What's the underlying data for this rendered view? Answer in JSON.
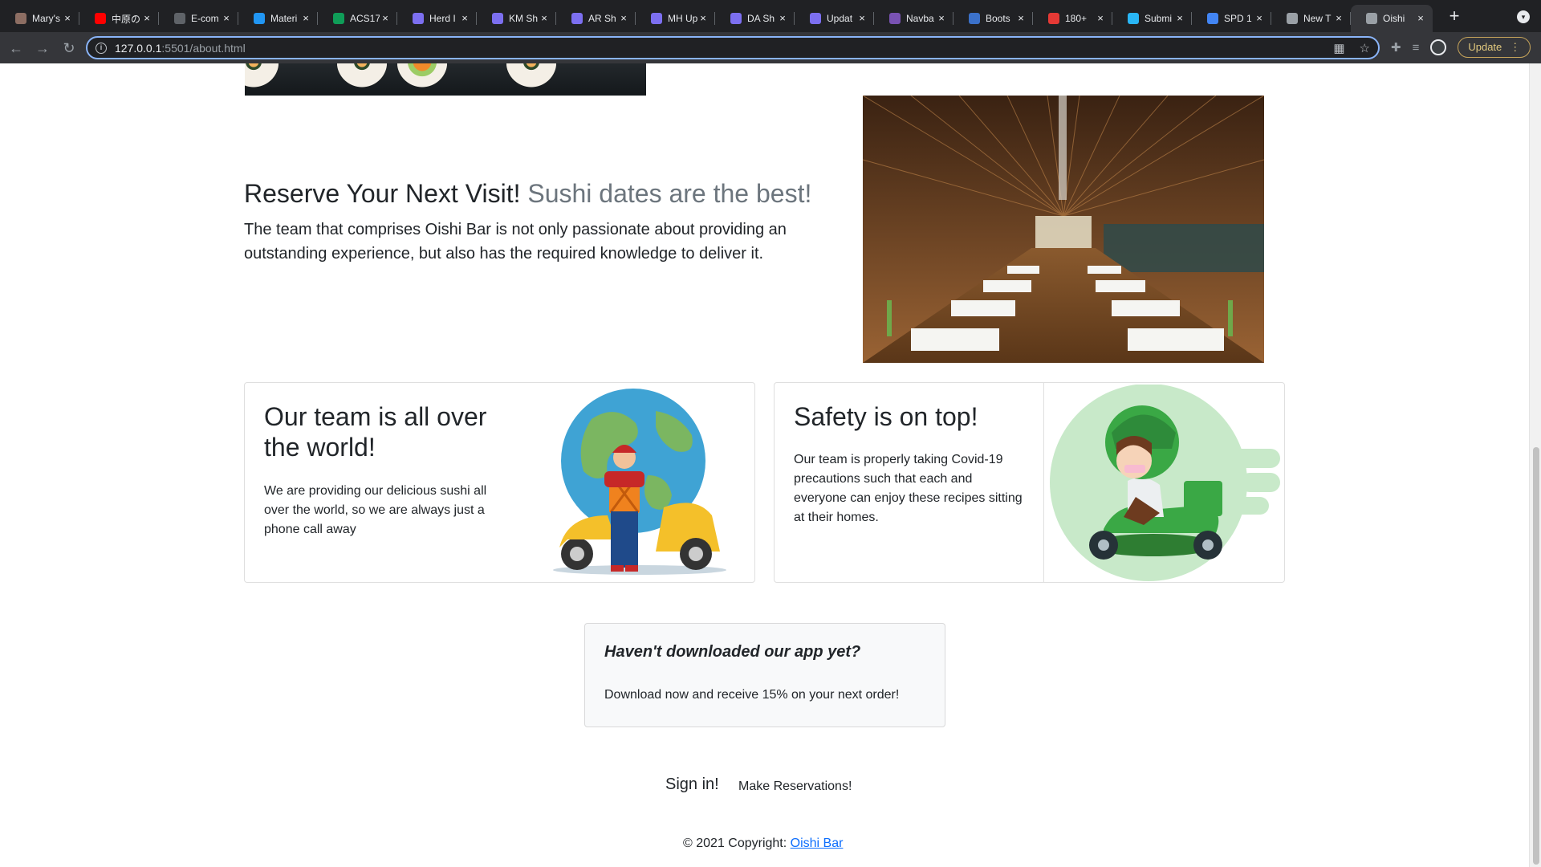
{
  "browser": {
    "tabs": [
      {
        "title": "Mary's",
        "icon": "cat-favicon-icon",
        "color": "#8d6e63"
      },
      {
        "title": "中原の",
        "icon": "youtube-icon",
        "color": "#ff0000"
      },
      {
        "title": "E-com",
        "icon": "document-w-icon",
        "color": "#5f6368"
      },
      {
        "title": "Materi",
        "icon": "material-bar-icon",
        "color": "#2196f3"
      },
      {
        "title": "ACS17",
        "icon": "sheets-plus-icon",
        "color": "#0f9d58"
      },
      {
        "title": "Herd I",
        "icon": "asterisk-gear-icon",
        "color": "#7c6ff0"
      },
      {
        "title": "KM Sh",
        "icon": "asterisk-gear-icon",
        "color": "#7c6ff0"
      },
      {
        "title": "AR Sh",
        "icon": "asterisk-gear-icon",
        "color": "#7c6ff0"
      },
      {
        "title": "MH Up",
        "icon": "asterisk-gear-icon",
        "color": "#7c6ff0"
      },
      {
        "title": "DA Sh",
        "icon": "asterisk-gear-icon",
        "color": "#7c6ff0"
      },
      {
        "title": "Updat",
        "icon": "asterisk-gear-icon",
        "color": "#7c6ff0"
      },
      {
        "title": "Navba",
        "icon": "bootstrap-b-icon",
        "color": "#7952b3"
      },
      {
        "title": "Boots",
        "icon": "mdb-icon",
        "color": "#3b71ca"
      },
      {
        "title": "180+",
        "icon": "red-helmet-icon",
        "color": "#e53935"
      },
      {
        "title": "Submi",
        "icon": "bar-chart-icon",
        "color": "#29b6f6"
      },
      {
        "title": "SPD 1",
        "icon": "docs-icon",
        "color": "#4285f4"
      },
      {
        "title": "New T",
        "icon": "chrome-icon",
        "color": "#9aa0a6"
      },
      {
        "title": "Oishi",
        "icon": "globe-icon",
        "color": "#9aa0a6",
        "active": true
      }
    ],
    "url_host": "127.0.0.1",
    "url_path": ":5501/about.html",
    "update_label": "Update"
  },
  "reserve": {
    "title": "Reserve Your Next Visit!",
    "subtitle": "Sushi dates are the best!",
    "text": "The team that comprises Oishi Bar is not only passionate about providing an outstanding experience, but also has the required knowledge to deliver it."
  },
  "cards": {
    "team": {
      "title": "Our team is all over the world!",
      "text": "We are providing our delicious sushi all over the world, so we are always just a phone call away"
    },
    "safety": {
      "title": "Safety is on top!",
      "text": "Our team is properly taking Covid-19 precautions such that each and everyone can enjoy these recipes sitting at their homes."
    }
  },
  "app_promo": {
    "title": "Haven't downloaded our app yet?",
    "text": "Download now and receive 15% on your next order!"
  },
  "footer": {
    "signin": "Sign in!",
    "reservations": "Make Reservations!",
    "copyright_prefix": "© 2021 Copyright: ",
    "copyright_link": "Oishi Bar"
  }
}
